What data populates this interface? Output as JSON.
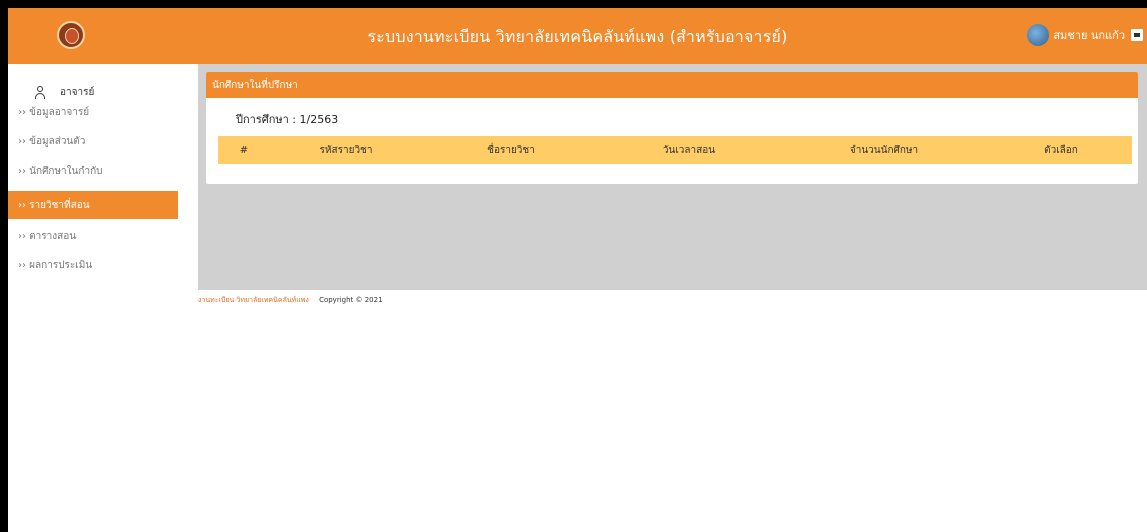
{
  "header": {
    "title": "ระบบงานทะเบียน วิทยาลัยเทคนิคลันท์แพง (สำหรับอาจารย์)",
    "user_name": "สมชาย นกแก้ว",
    "brand_color": "#f08a2c"
  },
  "sidebar": {
    "heading": "อาจารย์",
    "items": [
      {
        "label": "›› ข้อมูลอาจารย์"
      },
      {
        "label": "›› ข้อมูลส่วนตัว"
      },
      {
        "label": "›› นักศึกษาในกำกับ"
      },
      {
        "label": "›› รายวิชาที่สอน",
        "active": true
      },
      {
        "label": "›› ตารางสอน"
      },
      {
        "label": "›› ผลการประเมิน"
      }
    ]
  },
  "panel": {
    "title": "นักศึกษาในที่ปรึกษา",
    "year_label": "ปีการศึกษา : 1/2563",
    "columns": [
      "#",
      "รหัสรายวิชา",
      "ชื่อรายวิชา",
      "วันเวลาสอน",
      "จำนวนนักศึกษา",
      "ตัวเลือก"
    ],
    "header_color": "#ffcc66"
  },
  "footer": {
    "org": "งานทะเบียน วิทยาลัยเทคนิคลันท์แพง",
    "copyright": "Copyright © 2021"
  }
}
